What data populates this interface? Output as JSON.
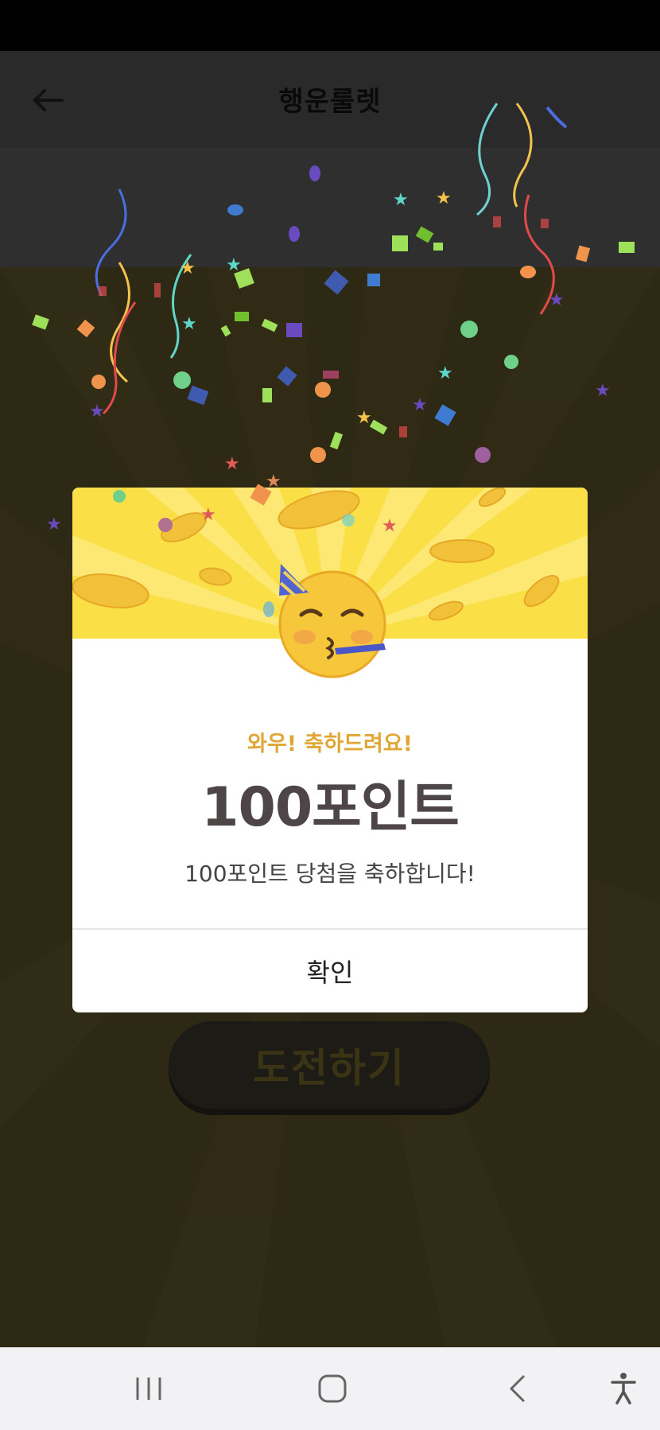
{
  "header": {
    "title": "행운룰렛",
    "back_icon": "arrow-left-icon"
  },
  "dialog": {
    "congrats_text": "와우! 축하드려요!",
    "points_text": "100포인트",
    "message_text": "100포인트 당첨을 축하합니다!",
    "confirm_label": "확인",
    "illustration_icon": "partying-face-icon"
  },
  "main": {
    "challenge_label": "도전하기"
  },
  "nav": {
    "recent_icon": "recent-apps-icon",
    "home_icon": "home-icon",
    "back_icon": "back-icon",
    "accessibility_icon": "accessibility-icon"
  },
  "colors": {
    "accent_yellow": "#fbdf46",
    "congrats_orange": "#e0a636",
    "points_text": "#4e4646",
    "background": "#2e2915"
  }
}
